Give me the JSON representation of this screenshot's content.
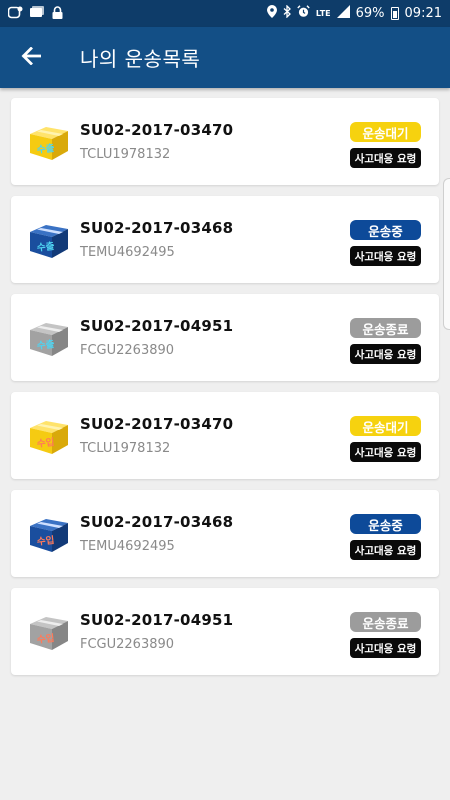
{
  "status_bar": {
    "battery": "69%",
    "time": "09:21",
    "network": "LTE"
  },
  "header": {
    "title": "나의 운송목록"
  },
  "colors": {
    "app_bar": "#134f86",
    "status_bar": "#0e3c69",
    "waiting": "#f6d20f",
    "moving": "#0d4a99",
    "done": "#9c9c9c"
  },
  "shipments": [
    {
      "number": "SU02-2017-03470",
      "container": "TCLU1978132",
      "type": "수출",
      "status": "운송대기",
      "guide": "사고대응 요령",
      "icon": "yellow-box-icon"
    },
    {
      "number": "SU02-2017-03468",
      "container": "TEMU4692495",
      "type": "수출",
      "status": "운송중",
      "guide": "사고대응 요령",
      "icon": "blue-box-icon"
    },
    {
      "number": "SU02-2017-04951",
      "container": "FCGU2263890",
      "type": "수출",
      "status": "운송종료",
      "guide": "사고대응 요령",
      "icon": "gray-box-icon"
    },
    {
      "number": "SU02-2017-03470",
      "container": "TCLU1978132",
      "type": "수입",
      "status": "운송대기",
      "guide": "사고대응 요령",
      "icon": "yellow-box-icon"
    },
    {
      "number": "SU02-2017-03468",
      "container": "TEMU4692495",
      "type": "수입",
      "status": "운송중",
      "guide": "사고대응 요령",
      "icon": "blue-box-icon"
    },
    {
      "number": "SU02-2017-04951",
      "container": "FCGU2263890",
      "type": "수입",
      "status": "운송종료",
      "guide": "사고대응 요령",
      "icon": "gray-box-icon"
    }
  ]
}
